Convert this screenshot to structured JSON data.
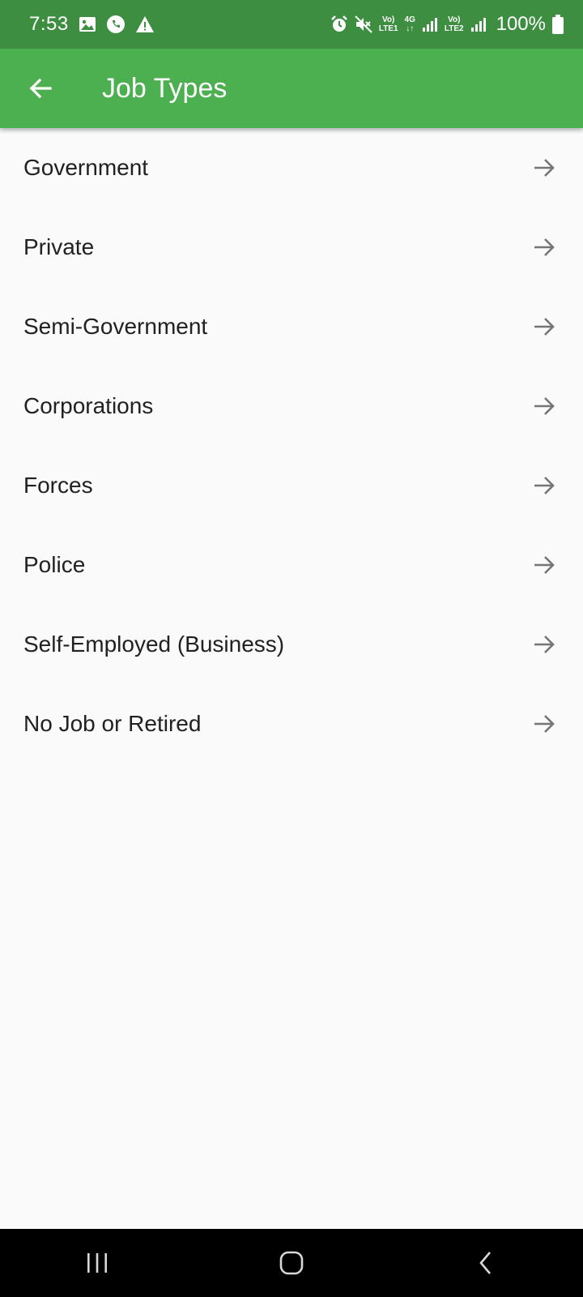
{
  "status_bar": {
    "time": "7:53",
    "net1_top": "Vo)",
    "net1_bottom": "LTE1",
    "net_type": "4G",
    "net2_top": "Vo)",
    "net2_bottom": "LTE2",
    "battery": "100%"
  },
  "app_bar": {
    "title": "Job Types",
    "color": "#4caf50"
  },
  "job_types": [
    {
      "label": "Government"
    },
    {
      "label": "Private"
    },
    {
      "label": "Semi-Government"
    },
    {
      "label": "Corporations"
    },
    {
      "label": "Forces"
    },
    {
      "label": "Police"
    },
    {
      "label": "Self-Employed (Business)"
    },
    {
      "label": "No Job or Retired"
    }
  ],
  "icons": {
    "back": "arrow-left-icon",
    "row": "arrow-right-icon",
    "nav": [
      "recents-icon",
      "home-icon",
      "back-icon"
    ]
  }
}
